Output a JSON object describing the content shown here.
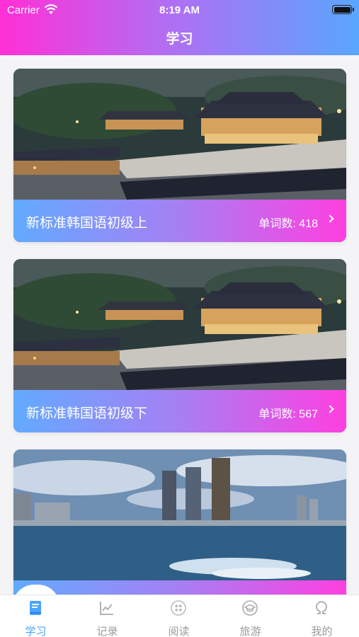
{
  "status_bar": {
    "carrier": "Carrier",
    "time": "8:19 AM"
  },
  "nav": {
    "title": "学习"
  },
  "books": [
    {
      "title": "新标准韩国语初级上",
      "count": "单词数: 418",
      "image": "palace-night-photo"
    },
    {
      "title": "新标准韩国语初级下",
      "count": "单词数: 567",
      "image": "palace-night-photo"
    },
    {
      "title": "",
      "count": "",
      "image": "city-skyline-sea-photo"
    }
  ],
  "tabbar": {
    "items": [
      {
        "label": "学习",
        "icon": "book-icon",
        "active": true
      },
      {
        "label": "记录",
        "icon": "chart-icon",
        "active": false
      },
      {
        "label": "阅读",
        "icon": "grid-icon",
        "active": false
      },
      {
        "label": "旅游",
        "icon": "graduation-cap-icon",
        "active": false
      },
      {
        "label": "我的",
        "icon": "omega-icon",
        "active": false
      }
    ]
  },
  "colors": {
    "accent": "#4aa3ff",
    "header_pink": "#ff2fd6",
    "header_blue": "#5aa6ff"
  }
}
